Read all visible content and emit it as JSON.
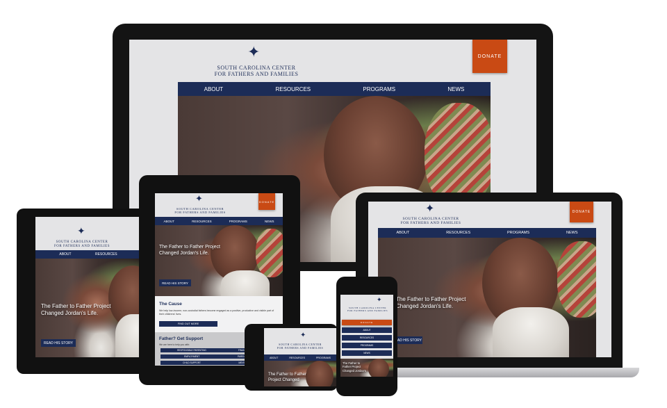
{
  "site": {
    "logo_line1": "South Carolina Center",
    "logo_line2": "for Fathers and Families",
    "logo_mark": "✦",
    "donate_label": "Donate",
    "nav": [
      "About",
      "Resources",
      "Programs",
      "News"
    ],
    "hero_title": "The Father to Father Project Changed Jordan's Life.",
    "hero_title_short": "The Father to Father Project Changed",
    "hero_title_phone": "The Father to Father Project Changed Jordan's",
    "story_button": "Read His Story",
    "cause_heading": "The Cause",
    "cause_text": "We help low-income, non-custodial fathers become engaged as a positive, productive and visible part of their childrens' lives.",
    "find_out_more": "Find Out More",
    "support_heading": "Father? Get Support",
    "support_sub": "We are here to help you with:",
    "support_items": [
      "Responsible Parenting",
      "Finances",
      "Employment",
      "Parenting",
      "Child Support",
      "Men's He"
    ]
  },
  "colors": {
    "navy": "#1c2c57",
    "donate": "#c94a14",
    "screen_bg": "#e4e4e6"
  }
}
